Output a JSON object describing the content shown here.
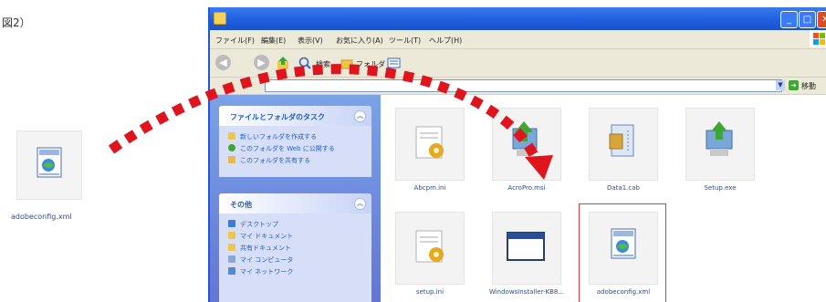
{
  "figure_label": "図2）",
  "standalone_file": {
    "name": "adobeconfig.xml",
    "icon": "xml-document-icon"
  },
  "window": {
    "titlebar": {
      "title": "",
      "minimize_glyph": "_",
      "maximize_glyph": "□",
      "close_glyph": "✕"
    },
    "menu": [
      "ファイル(F)",
      "編集(E)",
      "表示(V)",
      "お気に入り(A)",
      "ツール(T)",
      "ヘルプ(H)"
    ],
    "toolbar": {
      "back_label": "",
      "search_label": "検索",
      "folders_label": "フォルダ"
    },
    "address": {
      "value": "",
      "go_label": "移動"
    },
    "task_pane": {
      "file_tasks": {
        "title": "ファイルとフォルダのタスク",
        "items": [
          "新しいフォルダを作成する",
          "このフォルダを Web に公開する",
          "このフォルダを共有する"
        ]
      },
      "other_places": {
        "title": "その他",
        "items": [
          "デスクトップ",
          "マイ ドキュメント",
          "共有ドキュメント",
          "マイ コンピュータ",
          "マイ ネットワーク"
        ]
      }
    },
    "files": [
      {
        "name": "Abcpm.ini",
        "icon": "ini-settings-icon"
      },
      {
        "name": "AcroPro.msi",
        "icon": "installer-package-icon"
      },
      {
        "name": "Data1.cab",
        "icon": "cabinet-archive-icon"
      },
      {
        "name": "Setup.exe",
        "icon": "setup-installer-icon"
      },
      {
        "name": "setup.ini",
        "icon": "ini-settings-icon"
      },
      {
        "name": "WindowsInstaller-KB8...",
        "icon": "application-window-icon"
      },
      {
        "name": "adobeconfig.xml",
        "icon": "xml-document-icon",
        "selected": true
      }
    ],
    "dash_mark": "-"
  },
  "colors": {
    "arrow": "#e0141c",
    "selection_frame": "#e23a34",
    "titlebar": "#1f5fe0",
    "task_pane": "#6f8fe0"
  }
}
